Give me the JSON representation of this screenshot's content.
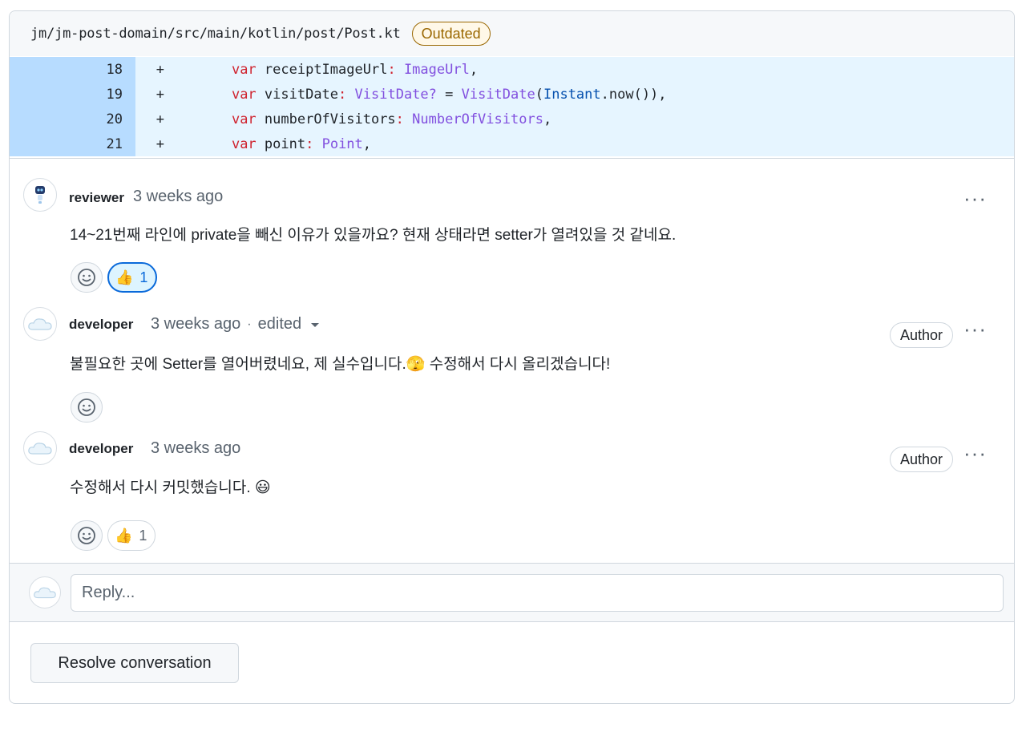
{
  "file": {
    "path": "jm/jm-post-domain/src/main/kotlin/post/Post.kt",
    "status_badge": "Outdated"
  },
  "diff": {
    "lines": [
      {
        "number": "18",
        "marker": "+",
        "tokens": [
          {
            "t": "    ",
            "c": ""
          },
          {
            "t": "var",
            "c": "kw"
          },
          {
            "t": " receiptImageUrl",
            "c": ""
          },
          {
            "t": ":",
            "c": "kw"
          },
          {
            "t": " ",
            "c": ""
          },
          {
            "t": "ImageUrl",
            "c": "ty"
          },
          {
            "t": ",",
            "c": ""
          }
        ]
      },
      {
        "number": "19",
        "marker": "+",
        "tokens": [
          {
            "t": "    ",
            "c": ""
          },
          {
            "t": "var",
            "c": "kw"
          },
          {
            "t": " visitDate",
            "c": ""
          },
          {
            "t": ":",
            "c": "kw"
          },
          {
            "t": " ",
            "c": ""
          },
          {
            "t": "VisitDate?",
            "c": "ty"
          },
          {
            "t": " = ",
            "c": ""
          },
          {
            "t": "VisitDate",
            "c": "ty"
          },
          {
            "t": "(",
            "c": ""
          },
          {
            "t": "Instant",
            "c": "fn"
          },
          {
            "t": ".now()),",
            "c": ""
          }
        ]
      },
      {
        "number": "20",
        "marker": "+",
        "tokens": [
          {
            "t": "    ",
            "c": ""
          },
          {
            "t": "var",
            "c": "kw"
          },
          {
            "t": " numberOfVisitors",
            "c": ""
          },
          {
            "t": ":",
            "c": "kw"
          },
          {
            "t": " ",
            "c": ""
          },
          {
            "t": "NumberOfVisitors",
            "c": "ty"
          },
          {
            "t": ",",
            "c": ""
          }
        ]
      },
      {
        "number": "21",
        "marker": "+",
        "tokens": [
          {
            "t": "    ",
            "c": ""
          },
          {
            "t": "var",
            "c": "kw"
          },
          {
            "t": " point",
            "c": ""
          },
          {
            "t": ":",
            "c": "kw"
          },
          {
            "t": " ",
            "c": ""
          },
          {
            "t": "Point",
            "c": "ty"
          },
          {
            "t": ",",
            "c": ""
          }
        ]
      }
    ]
  },
  "comments": [
    {
      "author": "reviewer",
      "time": "3 weeks ago",
      "body": "14~21번째 라인에 private을 빼신 이유가 있을까요? 현재 상태라면 setter가 열려있을 것 같네요.",
      "thumbs_count": "1",
      "thumbs_reacted": true
    },
    {
      "author": "developer",
      "time": "3 weeks ago",
      "edited": "edited",
      "author_badge": "Author",
      "body": "불필요한 곳에 Setter를 열어버렸네요, 제 실수입니다.",
      "body_emoji": "🫣",
      "body_suffix": " 수정해서 다시 올리겠습니다!"
    },
    {
      "author": "developer",
      "time": "3 weeks ago",
      "author_badge": "Author",
      "body": "수정해서 다시 커밋했습니다.",
      "body_emoji": "😃",
      "thumbs_count": "1",
      "thumbs_reacted": false
    }
  ],
  "more_icon": "···",
  "separator": "·",
  "thumbs_emoji": "👍",
  "reply": {
    "placeholder": "Reply..."
  },
  "actions": {
    "resolve_label": "Resolve conversation"
  },
  "colors": {
    "added_line_bg": "#e6f5ff",
    "added_gutter_bg": "#b7dcff",
    "keyword": "#cf222e",
    "type": "#8250df",
    "outdated": "#9a6700",
    "accent": "#0969da"
  }
}
